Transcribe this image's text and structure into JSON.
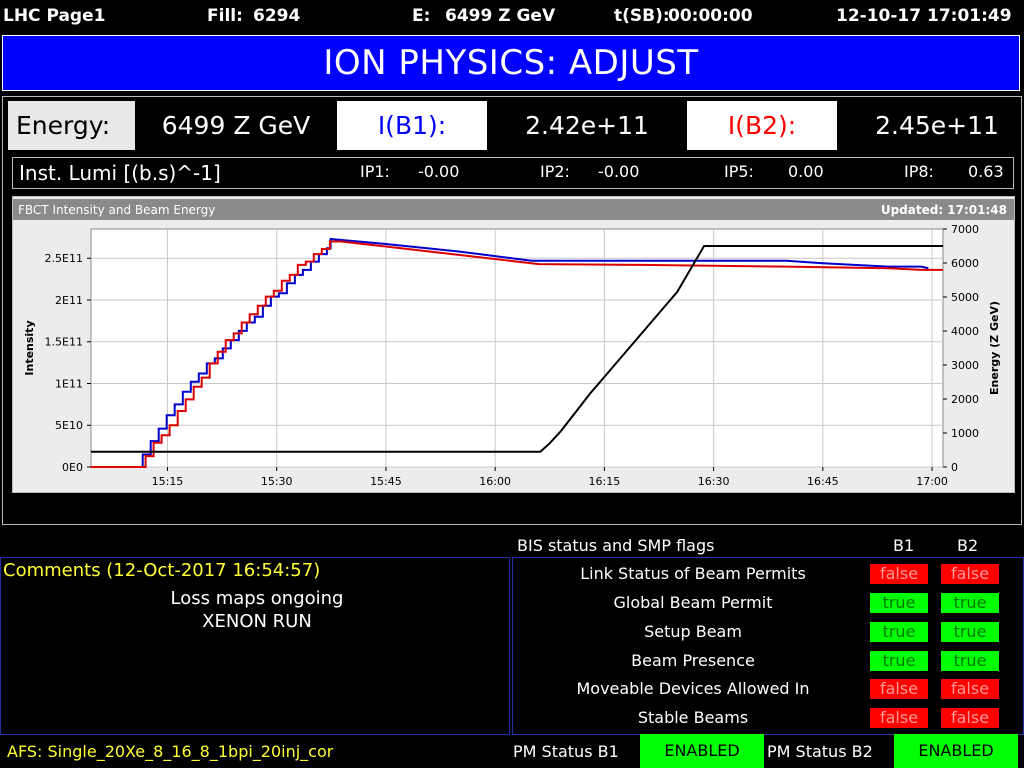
{
  "header": {
    "page": "LHC Page1",
    "fill_label": "Fill:",
    "fill": "6294",
    "energy_label": "E:",
    "energy": "6499 Z GeV",
    "tsb_label": "t(SB):",
    "tsb": "00:00:00",
    "datetime": "12-10-17 17:01:49"
  },
  "mode": "ION PHYSICS: ADJUST",
  "beam": {
    "energy_label": "Energy:",
    "energy_value": "6499 Z GeV",
    "b1_label": "I(B1):",
    "b1_value": "2.42e+11",
    "b2_label": "I(B2):",
    "b2_value": "2.45e+11"
  },
  "lumi": {
    "label": "Inst. Lumi [(b.s)^-1]",
    "ips": [
      {
        "name": "IP1:",
        "value": "-0.00"
      },
      {
        "name": "IP2:",
        "value": "-0.00"
      },
      {
        "name": "IP5:",
        "value": "0.00"
      },
      {
        "name": "IP8:",
        "value": "0.63"
      }
    ]
  },
  "chart_data": {
    "type": "line",
    "title": "FBCT Intensity and Beam Energy",
    "updated": "Updated: 17:01:48",
    "ylabel": "Intensity",
    "y2label": "Energy (Z GeV)",
    "x_ticks": [
      "15:15",
      "15:30",
      "15:45",
      "16:00",
      "16:15",
      "16:30",
      "16:45",
      "17:00"
    ],
    "x_tick_minutes": [
      915,
      930,
      945,
      960,
      975,
      990,
      1005,
      1020
    ],
    "xlim": [
      904.5,
      1021.5
    ],
    "y_ticks": [
      "0E0",
      "5E10",
      "1E11",
      "1.5E11",
      "2E11",
      "2.5E11"
    ],
    "ylim": [
      0,
      285000000000.0
    ],
    "y2_ticks": [
      "0",
      "1000",
      "2000",
      "3000",
      "4000",
      "5000",
      "6000",
      "7000"
    ],
    "y2lim": [
      0,
      7000
    ],
    "colors": {
      "b1": "#0000cc",
      "b2": "#dd0000",
      "energy": "#000000"
    },
    "series": [
      {
        "name": "B1",
        "axis": "y",
        "step_x": [
          904.5,
          911.2,
          911.6,
          912.7,
          913.8,
          914.9,
          916.0,
          917.1,
          918.2,
          919.3,
          920.4,
          921.5,
          922.6,
          923.7,
          924.8,
          925.9,
          927.0,
          928.1,
          929.2,
          930.3,
          931.4,
          932.5,
          933.6,
          934.7,
          935.8,
          936.9,
          937.4
        ],
        "step_y": [
          0,
          0,
          15000000000.0,
          31000000000.0,
          46000000000.0,
          62000000000.0,
          75000000000.0,
          90000000000.0,
          102000000000.0,
          112000000000.0,
          124000000000.0,
          130000000000.0,
          142000000000.0,
          152000000000.0,
          163000000000.0,
          173000000000.0,
          180000000000.0,
          193000000000.0,
          204000000000.0,
          208000000000.0,
          220000000000.0,
          230000000000.0,
          236000000000.0,
          246000000000.0,
          255000000000.0,
          262000000000.0,
          273000000000.0
        ],
        "x": [
          937.4,
          945,
          955,
          965,
          1000,
          1005,
          1014,
          1018.5,
          1019.5
        ],
        "y": [
          273000000000.0,
          267000000000.0,
          258000000000.0,
          247000000000.0,
          247000000000.0,
          244000000000.0,
          240000000000.0,
          240000000000.0,
          238000000000.0
        ]
      },
      {
        "name": "B2",
        "axis": "y",
        "step_x": [
          904.5,
          911.5,
          912.0,
          913.1,
          914.2,
          915.3,
          916.4,
          917.5,
          918.6,
          919.7,
          920.8,
          921.9,
          923.0,
          924.1,
          925.2,
          926.3,
          927.4,
          928.5,
          929.6,
          930.7,
          931.8,
          932.9,
          934.0,
          935.1,
          936.2,
          937.3,
          938.8
        ],
        "step_y": [
          0,
          0,
          13000000000.0,
          29000000000.0,
          38000000000.0,
          50000000000.0,
          67000000000.0,
          81000000000.0,
          96000000000.0,
          107000000000.0,
          124000000000.0,
          138000000000.0,
          152000000000.0,
          160000000000.0,
          173000000000.0,
          183000000000.0,
          193000000000.0,
          204000000000.0,
          211000000000.0,
          223000000000.0,
          230000000000.0,
          242000000000.0,
          246000000000.0,
          255000000000.0,
          261000000000.0,
          270000000000.0,
          270000000000.0
        ],
        "x": [
          938.8,
          945,
          955,
          966,
          980,
          1000,
          1014,
          1018.5,
          1021.5
        ],
        "y": [
          270000000000.0,
          264000000000.0,
          254000000000.0,
          243000000000.0,
          242000000000.0,
          240000000000.0,
          238000000000.0,
          236000000000.0,
          236000000000.0
        ]
      },
      {
        "name": "Energy",
        "axis": "y2",
        "x": [
          904.5,
          966.2,
          967.5,
          969.0,
          971.0,
          973.0,
          975.0,
          980.0,
          985.0,
          988.7,
          1021.5
        ],
        "y": [
          450,
          450,
          700,
          1050,
          1600,
          2150,
          2650,
          3900,
          5150,
          6499,
          6499
        ]
      }
    ]
  },
  "bis": {
    "title": "BIS status and SMP flags",
    "col_b1": "B1",
    "col_b2": "B2",
    "rows": [
      {
        "label": "Link Status of Beam Permits",
        "b1": "false",
        "b2": "false"
      },
      {
        "label": "Global Beam Permit",
        "b1": "true",
        "b2": "true"
      },
      {
        "label": "Setup Beam",
        "b1": "true",
        "b2": "true"
      },
      {
        "label": "Beam Presence",
        "b1": "true",
        "b2": "true"
      },
      {
        "label": "Moveable Devices Allowed In",
        "b1": "false",
        "b2": "false"
      },
      {
        "label": "Stable Beams",
        "b1": "false",
        "b2": "false"
      }
    ]
  },
  "comments": {
    "title": "Comments (12-Oct-2017 16:54:57)",
    "line1": "Loss maps ongoing",
    "line2": "XENON RUN"
  },
  "footer": {
    "afs": "AFS: Single_20Xe_8_16_8_1bpi_20inj_cor",
    "pm_b1_label": "PM Status B1",
    "pm_b1_value": "ENABLED",
    "pm_b2_label": "PM Status B2",
    "pm_b2_value": "ENABLED"
  }
}
